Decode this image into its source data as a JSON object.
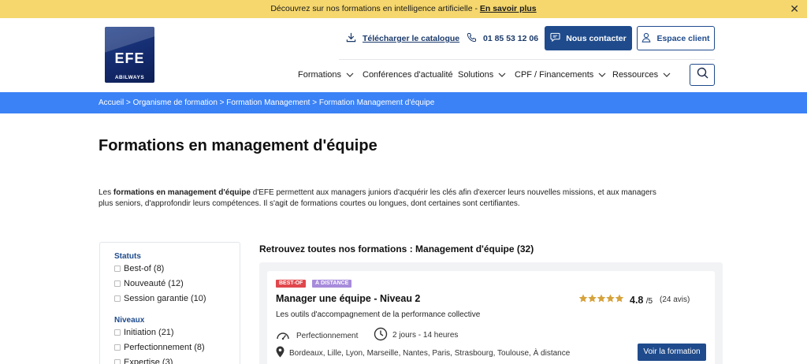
{
  "promo": {
    "text": "Découvrez sur nos formations en intelligence artificielle - ",
    "link": "En savoir plus",
    "close": "✕"
  },
  "logo": {
    "main": "EFE",
    "sub": "ABILWAYS"
  },
  "header": {
    "catalogue": "Télécharger le catalogue",
    "phone": "01 85 53 12 06",
    "contact": "Nous contacter",
    "client": "Espace client"
  },
  "nav": {
    "items": [
      {
        "label": "Formations",
        "has_menu": true
      },
      {
        "label": "Conférences d'actualité",
        "has_menu": false
      },
      {
        "label": "Solutions",
        "has_menu": true
      },
      {
        "label": "CPF / Financements",
        "has_menu": true
      },
      {
        "label": "Ressources",
        "has_menu": true
      }
    ]
  },
  "breadcrumb": "Accueil > Organisme de formation > Formation Management > Formation Management d'équipe",
  "page_title": "Formations en management d'équipe",
  "intro": {
    "before": "Les ",
    "bold": "formations en management d'équipe",
    "after": " d'EFE permettent aux managers juniors d'acquérir les clés afin d'exercer leurs nouvelles missions, et aux managers plus seniors, d'approfondir leurs compétences. Il s'agit de formations courtes ou longues, dont certaines sont certifiantes."
  },
  "filters": {
    "statut_title": "Statuts",
    "statut": [
      "Best-of (8)",
      "Nouveauté (12)",
      "Session garantie (10)"
    ],
    "niveaux_title": "Niveaux",
    "niveaux": [
      "Initiation (21)",
      "Perfectionnement (8)",
      "Expertise (3)"
    ]
  },
  "results": {
    "title": "Retrouvez toutes nos formations : Management d'équipe (32)",
    "card": {
      "badges": [
        {
          "label": "BEST-OF",
          "color": "#e0474c"
        },
        {
          "label": "À DISTANCE",
          "color": "#a78bdb"
        }
      ],
      "title": "Manager une équipe - Niveau 2",
      "subtitle": "Les outils d'accompagnement de la performance collective",
      "rating": "4.8",
      "rating_max": "/5",
      "rating_value": 4.8,
      "reviews": "(24 avis)",
      "level": "Perfectionnement",
      "duration": "2 jours - 14 heures",
      "locations": "Bordeaux, Lille, Lyon, Marseille, Nantes, Paris, Strasbourg, Toulouse, À distance",
      "cta": "Voir la formation"
    }
  },
  "colors": {
    "primary": "#1f4b8c",
    "breadcrumb_bg": "#3b82f6",
    "promo_bg": "#f5d76e",
    "star": "#d6a23a"
  }
}
